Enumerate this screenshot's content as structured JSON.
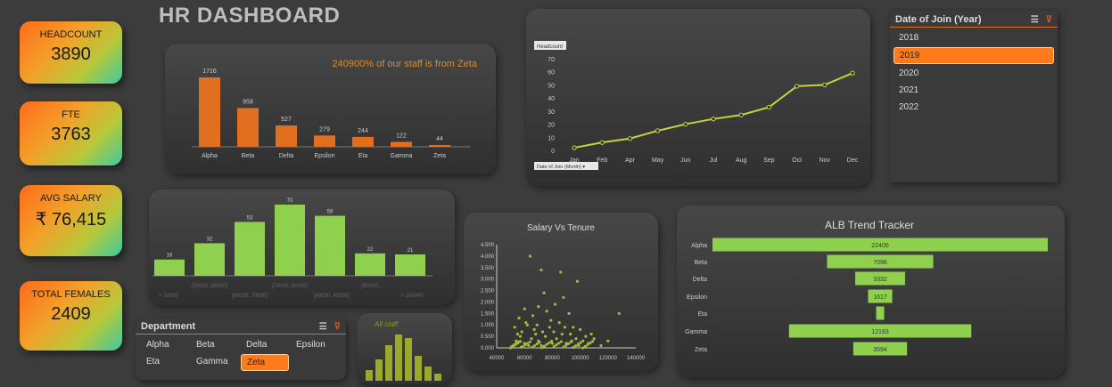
{
  "header": {
    "title": "HR DASHBOARD"
  },
  "kpis": [
    {
      "label": "HEADCOUNT",
      "value": "3890"
    },
    {
      "label": "FTE",
      "value": "3763"
    },
    {
      "label": "AVG SALARY",
      "value": "₹ 76,415"
    },
    {
      "label": "TOTAL FEMALES",
      "value": "2409"
    }
  ],
  "dept_chart": {
    "annotation": "240900% of our staff is from Zeta",
    "color": "#e0701f"
  },
  "month_chart": {
    "legend_label": "Headcount",
    "filter_label": "Date of Join (Month)",
    "color": "#c8d23c"
  },
  "salary_band_chart": {
    "color": "#8fd14f"
  },
  "scatter_chart": {
    "title": "Salary Vs Tenure",
    "color": "#a8b83a"
  },
  "alb_chart": {
    "title": "ALB Trend Tracker",
    "color": "#8fd14f"
  },
  "mini_chart": {
    "label": "All staff",
    "color": "#9aa82e"
  },
  "year_slicer": {
    "title": "Date of Join (Year)",
    "items": [
      "2018",
      "2019",
      "2020",
      "2021",
      "2022"
    ],
    "selected": "2019"
  },
  "dept_slicer": {
    "title": "Department",
    "items": [
      "Alpha",
      "Beta",
      "Delta",
      "Epsilon",
      "Eta",
      "Gamma",
      "Zeta"
    ],
    "selected": "Zeta"
  },
  "chart_data": [
    {
      "type": "bar",
      "id": "department",
      "categories": [
        "Alpha",
        "Beta",
        "Delta",
        "Epsilon",
        "Eta",
        "Gamma",
        "Zeta"
      ],
      "values": [
        1716,
        958,
        527,
        279,
        244,
        122,
        44
      ],
      "title": "",
      "annotation": "240900% of our staff is from Zeta"
    },
    {
      "type": "line",
      "id": "join_month",
      "categories": [
        "Jan",
        "Feb",
        "Apr",
        "May",
        "Jun",
        "Jul",
        "Aug",
        "Sep",
        "Oct",
        "Nov",
        "Dec"
      ],
      "series": [
        {
          "name": "Headcount",
          "values": [
            2,
            6,
            9,
            15,
            20,
            24,
            27,
            33,
            49,
            50,
            59
          ]
        }
      ],
      "ylim": [
        0,
        70
      ],
      "yticks": [
        0,
        10,
        20,
        30,
        40,
        50,
        60,
        70
      ]
    },
    {
      "type": "bar",
      "id": "salary_band",
      "categories": [
        "< 30000",
        "[30000, 50000]",
        "[50000, 70000]",
        "[70000, 90000]",
        "[90000, 110000]",
        "[90000...",
        "> 100000"
      ],
      "tick_labels": [
        "< 30000",
        "[50000, 60000]",
        "[60000, 70000]",
        "[70000, 80000]",
        "[80000, 90000]",
        "[90000...",
        "> 100000"
      ],
      "values": [
        16,
        32,
        53,
        70,
        59,
        22,
        21
      ]
    },
    {
      "type": "scatter",
      "id": "salary_vs_tenure",
      "title": "Salary Vs Tenure",
      "xlim": [
        40000,
        140000
      ],
      "xticks": [
        40000,
        60000,
        80000,
        100000,
        120000,
        140000
      ],
      "ylim": [
        0,
        4.5
      ],
      "yticks": [
        "0.000",
        "0.500",
        "1.000",
        "1.500",
        "2.000",
        "2.500",
        "3.000",
        "3.500",
        "4.000",
        "4.500"
      ],
      "points": [
        [
          64000,
          4.0
        ],
        [
          72000,
          3.4
        ],
        [
          86000,
          3.3
        ],
        [
          98000,
          2.9
        ],
        [
          74000,
          2.4
        ],
        [
          88000,
          2.2
        ],
        [
          82000,
          1.9
        ],
        [
          60000,
          1.7
        ],
        [
          70000,
          1.8
        ],
        [
          76000,
          1.6
        ],
        [
          92000,
          1.5
        ],
        [
          128000,
          1.5
        ],
        [
          66000,
          1.4
        ],
        [
          56000,
          1.3
        ],
        [
          79000,
          1.2
        ],
        [
          85000,
          1.1
        ],
        [
          62000,
          1.0
        ],
        [
          95000,
          0.9
        ],
        [
          100000,
          0.8
        ],
        [
          58000,
          0.7
        ],
        [
          68000,
          0.6
        ],
        [
          104000,
          0.5
        ],
        [
          110000,
          0.4
        ],
        [
          120000,
          0.3
        ],
        [
          54000,
          0.3
        ],
        [
          60000,
          0.2
        ],
        [
          65000,
          0.4
        ],
        [
          70000,
          0.3
        ],
        [
          75000,
          0.5
        ],
        [
          80000,
          0.2
        ],
        [
          52000,
          0.1
        ],
        [
          57000,
          0.5
        ],
        [
          63000,
          0.1
        ],
        [
          67000,
          0.8
        ],
        [
          72000,
          0.1
        ],
        [
          78000,
          0.9
        ],
        [
          83000,
          0.4
        ],
        [
          87000,
          0.6
        ],
        [
          90000,
          0.2
        ],
        [
          94000,
          0.3
        ],
        [
          99000,
          0.1
        ],
        [
          106000,
          0.2
        ],
        [
          115000,
          0.1
        ],
        [
          53000,
          0.9
        ],
        [
          55000,
          0.6
        ],
        [
          61000,
          1.1
        ],
        [
          69000,
          1.0
        ],
        [
          73000,
          0.7
        ],
        [
          81000,
          0.7
        ],
        [
          89000,
          0.9
        ],
        [
          93000,
          0.6
        ],
        [
          97000,
          0.4
        ],
        [
          102000,
          0.3
        ],
        [
          108000,
          0.6
        ]
      ]
    },
    {
      "type": "bar",
      "id": "alb_trend",
      "orientation": "horizontal-centered",
      "title": "ALB Trend Tracker",
      "categories": [
        "Alpha",
        "Beta",
        "Delta",
        "Epsilon",
        "Eta",
        "Gamma",
        "Zeta"
      ],
      "values": [
        22406,
        7096,
        3332,
        1617,
        null,
        12183,
        3594
      ]
    },
    {
      "type": "bar",
      "id": "all_staff_mini",
      "title": "All staff",
      "values": [
        3,
        6,
        10,
        13,
        12,
        7,
        4,
        2
      ]
    }
  ]
}
